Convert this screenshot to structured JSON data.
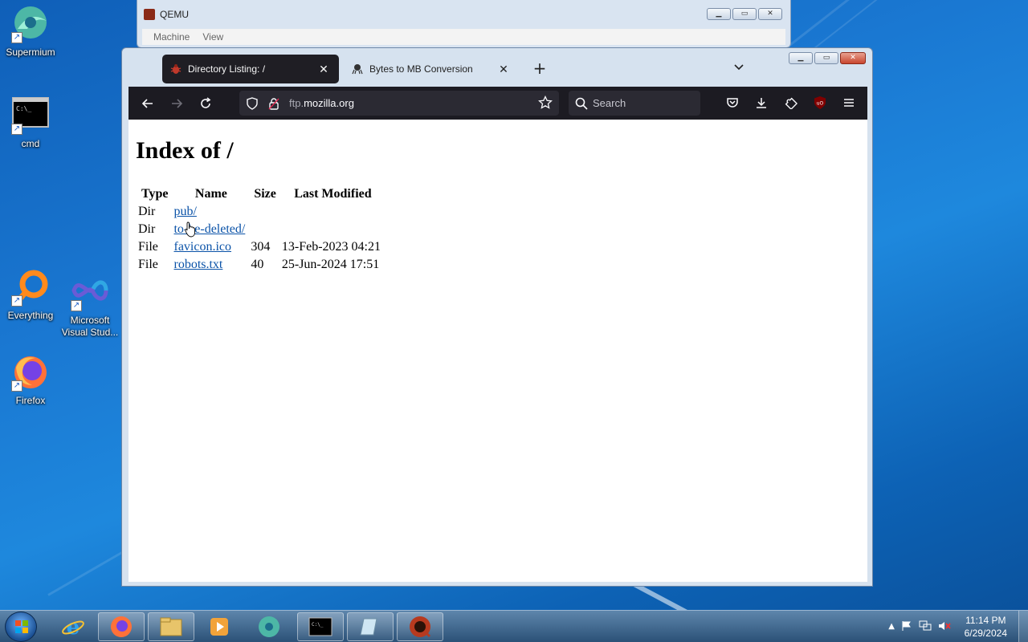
{
  "desktop": {
    "icons": [
      {
        "label": "Supermium",
        "icon": "supermium-icon"
      },
      {
        "label": "cmd",
        "icon": "cmd-icon"
      },
      {
        "label": "Everything",
        "icon": "everything-icon"
      },
      {
        "label": "Microsoft Visual Stud...",
        "icon": "visual-studio-icon"
      },
      {
        "label": "Firefox",
        "icon": "firefox-icon"
      }
    ]
  },
  "qemu": {
    "title": "QEMU",
    "menu": [
      "Machine",
      "View"
    ]
  },
  "browser": {
    "tabs": [
      {
        "label": "Directory Listing: /",
        "active": true,
        "icon": "bug-favicon-icon"
      },
      {
        "label": "Bytes to MB Conversion",
        "active": false,
        "icon": "qemu-favicon-icon"
      }
    ],
    "url": {
      "prefix": "ftp.",
      "domain": "mozilla.org"
    },
    "search_placeholder": "Search",
    "extension_badge": "uO"
  },
  "page": {
    "heading": "Index of /",
    "columns": [
      "Type",
      "Name",
      "Size",
      "Last Modified"
    ],
    "rows": [
      {
        "type": "Dir",
        "name": "pub/",
        "size": "",
        "modified": ""
      },
      {
        "type": "Dir",
        "name": "to-be-deleted/",
        "size": "",
        "modified": ""
      },
      {
        "type": "File",
        "name": "favicon.ico",
        "size": "304",
        "modified": "13-Feb-2023 04:21"
      },
      {
        "type": "File",
        "name": "robots.txt",
        "size": "40",
        "modified": "25-Jun-2024 17:51"
      }
    ]
  },
  "taskbar": {
    "items": [
      "start-orb-icon",
      "internet-explorer-icon",
      "firefox-icon",
      "file-explorer-icon",
      "media-player-icon",
      "supermium-icon",
      "cmd-icon",
      "notepad-icon",
      "qemu-icon"
    ],
    "clock": {
      "time": "11:14 PM",
      "date": "6/29/2024"
    }
  },
  "colors": {
    "link": "#0b53a8",
    "toolbar": "#1c1b22",
    "urlbar": "#2b2a33",
    "desktop": "#1a78d2"
  }
}
